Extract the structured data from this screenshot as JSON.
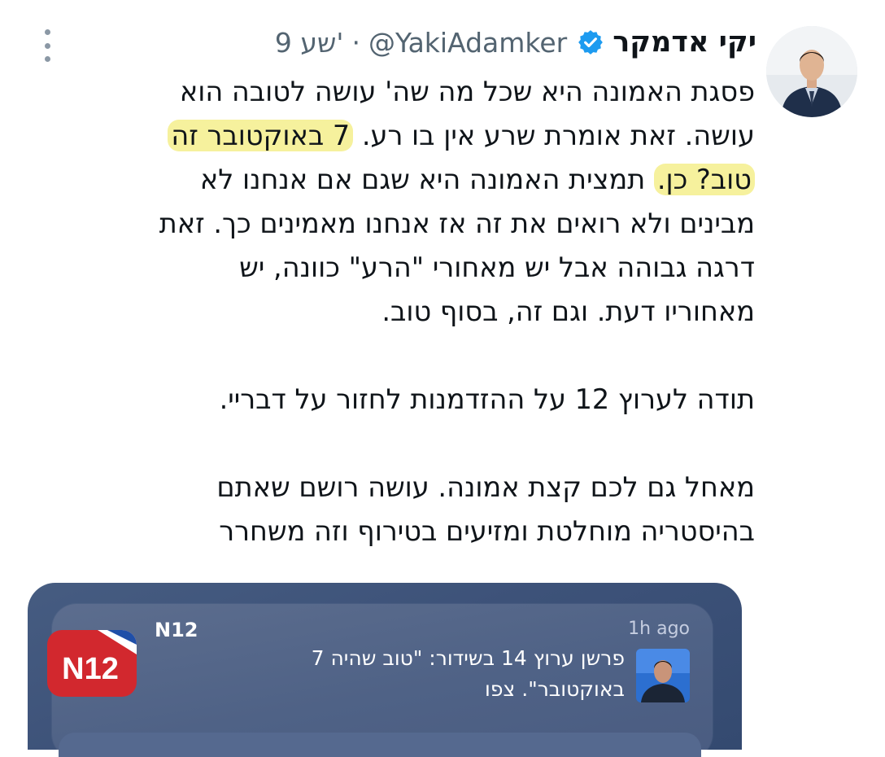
{
  "tweet": {
    "author": {
      "display_name": "יקי אדמקר",
      "handle": "@YakiAdamker",
      "separator": "·",
      "time": "9 שע'",
      "verified_icon": "verified-badge-icon"
    },
    "more_icon": "more-options-icon",
    "body": {
      "line1": "פסגת האמונה היא שכל מה שה' עושה לטובה הוא",
      "line2_plain": "עושה. זאת אומרת שרע אין בו רע. ",
      "line2_highlight": "7 באוקטובר זה",
      "line3_highlight": "טוב? כן.",
      "line3_plain": " תמצית האמונה היא שגם אם אנחנו לא",
      "line4": "מבינים ולא רואים את זה אז אנחנו מאמינים כך. זאת",
      "line5": "דרגה גבוהה אבל יש מאחורי \"הרע\" כוונה, יש",
      "line6": "מאחוריו דעת. וגם זה, בסוף טוב.",
      "line7": "תודה לערוץ 12 על ההזדמנות לחזור על דבריי.",
      "line8": "מאחל גם לכם קצת אמונה. עושה רושם שאתם",
      "line9": "בהיסטריה מוחלטת ומזיעים בטירוף וזה משחרר"
    },
    "highlight_color": "#f6f19d"
  },
  "notification": {
    "app_name": "N12",
    "app_icon_text": "N12",
    "time": "1h ago",
    "text_line1": "פרשן ערוץ 14 בשידור: \"טוב שהיה 7",
    "text_line2": "באוקטובר\". צפו",
    "colors": {
      "card": "#3d5279",
      "icon_red": "#d2282e"
    }
  }
}
